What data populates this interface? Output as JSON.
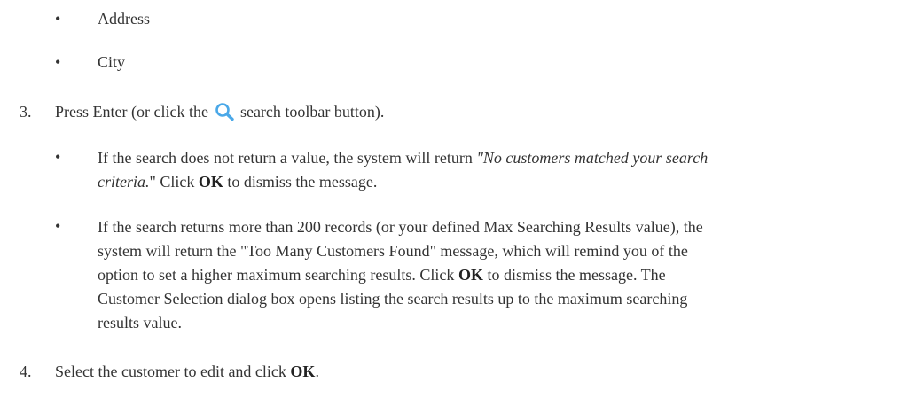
{
  "bullets_top": [
    {
      "marker": "•",
      "text": "Address"
    },
    {
      "marker": "•",
      "text": "City"
    }
  ],
  "step3": {
    "number": "3.",
    "text_before_icon": "Press Enter (or click the",
    "icon": "search-icon",
    "icon_color": "#4aa8e8",
    "text_after_icon": "search toolbar button)."
  },
  "step3_bullets": {
    "b1": {
      "marker": "•",
      "part1": "If the search does not return a value, the system will return ",
      "quote": "\"No customers matched your search criteria.",
      "part2": "\" Click ",
      "ok": "OK",
      "part3": " to dismiss the message."
    },
    "b2": {
      "marker": "•",
      "part1": "If the search returns more than 200 records (or your defined Max Searching Results value), the system will return the \"Too Many Customers Found\" message, which will remind you of the option to set a higher maximum searching results. Click ",
      "ok": "OK",
      "part2": " to dismiss the message. The Customer Selection dialog box opens listing the search results up to the maximum searching results value."
    }
  },
  "step4": {
    "number": "4.",
    "text": "Select the customer to edit and click ",
    "ok": "OK",
    "end": "."
  }
}
